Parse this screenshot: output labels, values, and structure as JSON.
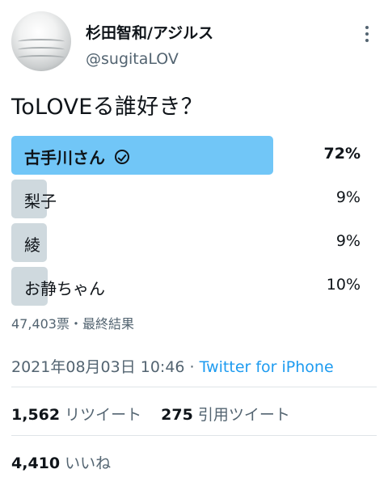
{
  "author": {
    "display_name": "杉田智和/アジルス",
    "handle": "@sugitaLOV"
  },
  "tweet": {
    "text": "ToLOVEる誰好き？"
  },
  "poll": {
    "options": [
      {
        "label": "古手川さん",
        "percent_label": "72%",
        "percent": 72,
        "winner": true
      },
      {
        "label": "梨子",
        "percent_label": "9%",
        "percent": 9,
        "winner": false
      },
      {
        "label": "綾",
        "percent_label": "9%",
        "percent": 9,
        "winner": false
      },
      {
        "label": "お静ちゃん",
        "percent_label": "10%",
        "percent": 10,
        "winner": false
      }
    ],
    "summary": "47,403票・最終結果"
  },
  "meta": {
    "timestamp": "2021年08月03日 10:46",
    "separator": " · ",
    "source": "Twitter for iPhone"
  },
  "stats": {
    "retweets_count": "1,562",
    "retweets_label": "リツイート",
    "quotes_count": "275",
    "quotes_label": "引用ツイート",
    "likes_count": "4,410",
    "likes_label": "いいね"
  },
  "colors": {
    "winner_bar": "#71c6f7",
    "bar": "#cfd9de",
    "link": "#1d9bf0",
    "secondary_text": "#536471"
  }
}
